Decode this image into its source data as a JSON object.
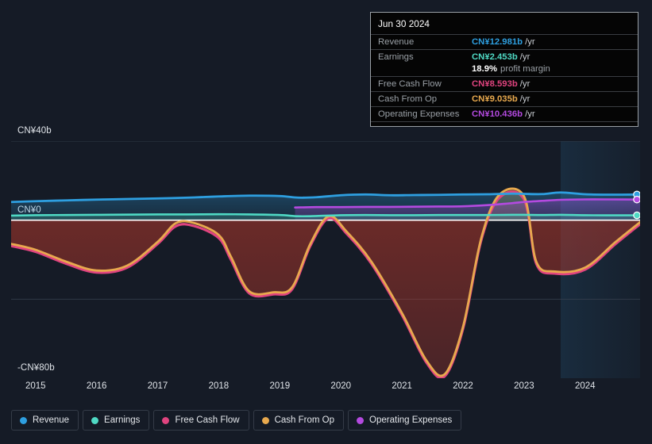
{
  "chart_data": {
    "type": "area",
    "title": "",
    "xlabel": "",
    "ylabel": "",
    "currency": "CN¥",
    "ylim": [
      -80,
      40
    ],
    "grid": true,
    "y_ticks": [
      {
        "value": 40,
        "label": "CN¥40b"
      },
      {
        "value": 0,
        "label": "CN¥0"
      },
      {
        "value": -80,
        "label": "-CN¥80b"
      }
    ],
    "x_ticks": [
      "2015",
      "2016",
      "2017",
      "2018",
      "2019",
      "2020",
      "2021",
      "2022",
      "2023",
      "2024"
    ],
    "x_range": [
      2014.6,
      2024.9
    ],
    "forecast_start": "2023.6",
    "legend_position": "bottom",
    "series": [
      {
        "name": "Revenue",
        "color": "#2e9fe0",
        "x": [
          2014.6,
          2015.0,
          2015.5,
          2016.0,
          2016.5,
          2017.0,
          2017.5,
          2018.0,
          2018.5,
          2019.0,
          2019.3,
          2019.6,
          2020.0,
          2020.4,
          2020.8,
          2021.2,
          2021.6,
          2022.0,
          2022.4,
          2022.8,
          2023.0,
          2023.3,
          2023.6,
          2024.0,
          2024.4,
          2024.9
        ],
        "values": [
          9.2,
          9.6,
          10.0,
          10.4,
          10.7,
          11.0,
          11.4,
          12.0,
          12.4,
          12.2,
          11.4,
          11.6,
          12.6,
          13.0,
          12.6,
          12.7,
          12.8,
          13.0,
          13.1,
          13.4,
          13.3,
          13.2,
          14.0,
          13.1,
          12.9,
          12.981
        ]
      },
      {
        "name": "Earnings",
        "color": "#4fd9c4",
        "x": [
          2014.6,
          2015.0,
          2015.5,
          2016.0,
          2016.5,
          2017.0,
          2017.5,
          2018.0,
          2018.5,
          2019.0,
          2019.3,
          2019.6,
          2020.0,
          2020.4,
          2020.8,
          2021.2,
          2021.6,
          2022.0,
          2022.4,
          2022.8,
          2023.0,
          2023.3,
          2023.6,
          2024.0,
          2024.4,
          2024.9
        ],
        "values": [
          2.3,
          2.5,
          2.6,
          2.7,
          2.8,
          2.9,
          2.9,
          3.0,
          2.9,
          2.6,
          2.0,
          2.1,
          2.5,
          2.6,
          2.5,
          2.5,
          2.6,
          2.6,
          2.6,
          2.7,
          2.7,
          2.6,
          2.7,
          2.5,
          2.45,
          2.453
        ]
      },
      {
        "name": "Free Cash Flow",
        "color": "#e0447f",
        "x": [
          2014.6,
          2015.0,
          2015.5,
          2016.0,
          2016.5,
          2017.0,
          2017.3,
          2017.6,
          2018.0,
          2018.2,
          2018.5,
          2018.9,
          2019.2,
          2019.5,
          2019.8,
          2020.1,
          2020.5,
          2021.0,
          2021.4,
          2021.7,
          2022.0,
          2022.3,
          2022.6,
          2023.0,
          2023.2,
          2023.5,
          2024.0,
          2024.5,
          2024.9
        ],
        "values": [
          -13.0,
          -16.0,
          -22.0,
          -26.5,
          -24.0,
          -12.0,
          -3.0,
          -3.0,
          -9.0,
          -20.0,
          -37.0,
          -37.5,
          -35.0,
          -13.0,
          1.0,
          -7.0,
          -22.0,
          -48.0,
          -72.0,
          -79.0,
          -55.0,
          -10.0,
          11.5,
          10.5,
          -22.0,
          -27.0,
          -25.0,
          -12.0,
          -2.0
        ]
      },
      {
        "name": "Cash From Op",
        "color": "#e8a94e",
        "x": [
          2014.6,
          2015.0,
          2015.5,
          2016.0,
          2016.5,
          2017.0,
          2017.3,
          2017.6,
          2018.0,
          2018.2,
          2018.5,
          2018.9,
          2019.2,
          2019.5,
          2019.8,
          2020.1,
          2020.5,
          2021.0,
          2021.4,
          2021.7,
          2022.0,
          2022.3,
          2022.6,
          2023.0,
          2023.2,
          2023.5,
          2024.0,
          2024.5,
          2024.9
        ],
        "values": [
          -12.0,
          -15.0,
          -21.0,
          -25.5,
          -23.0,
          -11.0,
          -1.5,
          -1.5,
          -7.5,
          -18.5,
          -36.0,
          -36.5,
          -34.0,
          -12.0,
          2.0,
          -6.0,
          -21.0,
          -47.0,
          -71.0,
          -78.0,
          -54.0,
          -9.0,
          13.0,
          12.0,
          -21.0,
          -26.0,
          -24.0,
          -11.0,
          -1.0
        ]
      },
      {
        "name": "Operating Expenses",
        "color": "#b44ae0",
        "x": [
          2019.25,
          2019.6,
          2020.0,
          2020.4,
          2020.8,
          2021.2,
          2021.6,
          2022.0,
          2022.4,
          2022.8,
          2023.0,
          2023.3,
          2023.6,
          2024.0,
          2024.4,
          2024.9
        ],
        "values": [
          6.4,
          6.6,
          6.6,
          6.7,
          6.7,
          6.8,
          6.9,
          7.0,
          7.6,
          8.6,
          9.2,
          9.8,
          10.3,
          10.5,
          10.5,
          10.436
        ]
      }
    ]
  },
  "tooltip": {
    "date": "Jun 30 2024",
    "rows": [
      {
        "label": "Revenue",
        "value": "CN¥12.981b",
        "unit": "/yr",
        "color": "#2e9fe0"
      },
      {
        "label": "Earnings",
        "value": "CN¥2.453b",
        "unit": "/yr",
        "color": "#4fd9c4"
      },
      {
        "label": "",
        "value": "18.9%",
        "unit": "profit margin",
        "color": "#ffffff"
      },
      {
        "label": "Free Cash Flow",
        "value": "CN¥8.593b",
        "unit": "/yr",
        "color": "#e0447f"
      },
      {
        "label": "Cash From Op",
        "value": "CN¥9.035b",
        "unit": "/yr",
        "color": "#e8a94e"
      },
      {
        "label": "Operating Expenses",
        "value": "CN¥10.436b",
        "unit": "/yr",
        "color": "#b44ae0"
      }
    ]
  },
  "legend": {
    "items": [
      {
        "label": "Revenue",
        "color": "#2e9fe0"
      },
      {
        "label": "Earnings",
        "color": "#4fd9c4"
      },
      {
        "label": "Free Cash Flow",
        "color": "#e0447f"
      },
      {
        "label": "Cash From Op",
        "color": "#e8a94e"
      },
      {
        "label": "Operating Expenses",
        "color": "#b44ae0"
      }
    ]
  },
  "theme": {
    "background": "#151b26",
    "grid_color": "#3a4250",
    "zero_line": "#ffffff"
  }
}
